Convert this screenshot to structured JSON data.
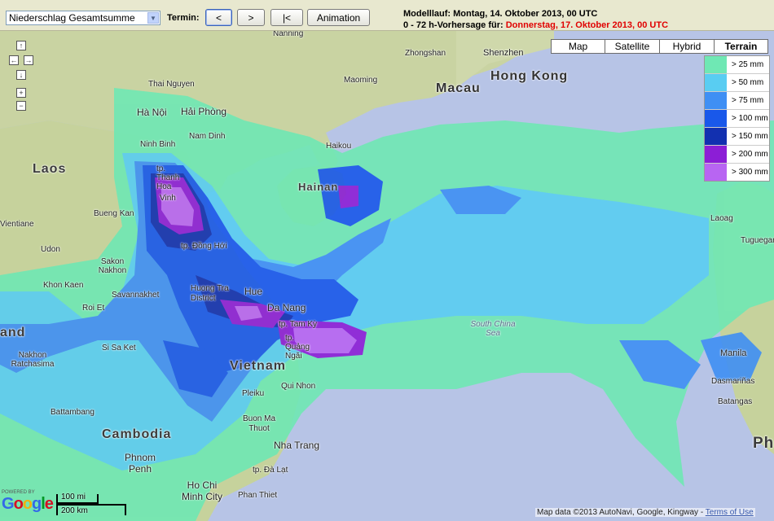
{
  "toolbar": {
    "parameter_select": "Niederschlag Gesamtsumme",
    "termin_label": "Termin:",
    "prev_label": "<",
    "next_label": ">",
    "first_label": "|<",
    "animation_label": "Animation",
    "model_run_label": "Modelllauf: Montag, 14. Oktober 2013, 00 UTC",
    "forecast_prefix": "0 - 72 h-Vorhersage für:",
    "forecast_date": "Donnerstag, 17. Oktober 2013, 00 UTC"
  },
  "map_types": [
    {
      "label": "Map",
      "active": false
    },
    {
      "label": "Satellite",
      "active": false
    },
    {
      "label": "Hybrid",
      "active": false
    },
    {
      "label": "Terrain",
      "active": true
    }
  ],
  "legend": [
    {
      "label": "> 25 mm",
      "color": "#6fe8b4"
    },
    {
      "label": "> 50 mm",
      "color": "#59cdf2"
    },
    {
      "label": "> 75 mm",
      "color": "#3f8ff4"
    },
    {
      "label": "> 100 mm",
      "color": "#1958ea"
    },
    {
      "label": "> 150 mm",
      "color": "#1230b0"
    },
    {
      "label": "> 200 mm",
      "color": "#8c1ed6"
    },
    {
      "label": "> 300 mm",
      "color": "#b865f2"
    }
  ],
  "pan_controls": {
    "up": "↑",
    "left": "←",
    "right": "→",
    "down": "↓",
    "zoom_in": "+",
    "zoom_out": "−"
  },
  "place_labels": {
    "nanning": "Nanning",
    "zhongshan": "Zhongshan",
    "shenzhen": "Shenzhen",
    "macau": "Macau",
    "hong_kong": "Hong Kong",
    "thai_nguyen": "Thai Nguyen",
    "maoming": "Maoming",
    "ha_noi": "Hà Nội",
    "hai_phong": "Hải Phòng",
    "nam_dinh": "Nam Dinh",
    "ninh_binh": "Ninh Binh",
    "haikou": "Haikou",
    "laos": "Laos",
    "thanh_hoa": "tp. Thanh Hoa",
    "vinh": "Vinh",
    "hainan": "Hainan",
    "bueng_kan": "Bueng Kan",
    "vientiane": "Vientiane",
    "udon": "Udon",
    "sakon_nakhon": "Sakon Nakhon",
    "dong_hoi": "tp. Đồng Hới",
    "khon_kaen": "Khon Kaen",
    "savannakhet": "Savannakhet",
    "huong_tra": "Huong Tra District",
    "hue": "Hue",
    "da_nang": "Da Nang",
    "roi_et": "Roi Et",
    "tam_ky": "tp. Tam Kỳ",
    "quang_ngai": "tp. Quảng Ngãi",
    "south_china_sea": "South China Sea",
    "thailand_partial": "and",
    "si_sa_ket": "Si Sa Ket",
    "nakhon_ratchasima": "Nakhon Ratchasima",
    "vietnam": "Vietnam",
    "pleiku": "Pleiku",
    "qui_nhon": "Qui Nhon",
    "battambang": "Battambang",
    "cambodia": "Cambodia",
    "buon_ma_thuot": "Buon Ma Thuot",
    "nha_trang": "Nha Trang",
    "phnom_penh": "Phnom Penh",
    "da_lat": "tp. Đà Lạt",
    "ho_chi_minh": "Ho Chi Minh City",
    "phan_thiet": "Phan Thiet",
    "laoag": "Laoag",
    "tuguegarao": "Tuguegarao",
    "manila": "Manila",
    "dasmarinas": "Dasmariñas",
    "batangas": "Batangas",
    "philippines_partial": "Ph"
  },
  "scale": {
    "miles": "100 mi",
    "km": "200 km"
  },
  "logo": {
    "powered_by": "POWERED BY",
    "google": "Google"
  },
  "attribution": {
    "text": "Map data ©2013 AutoNavi, Google, Kingway - ",
    "terms": "Terms of Use"
  }
}
